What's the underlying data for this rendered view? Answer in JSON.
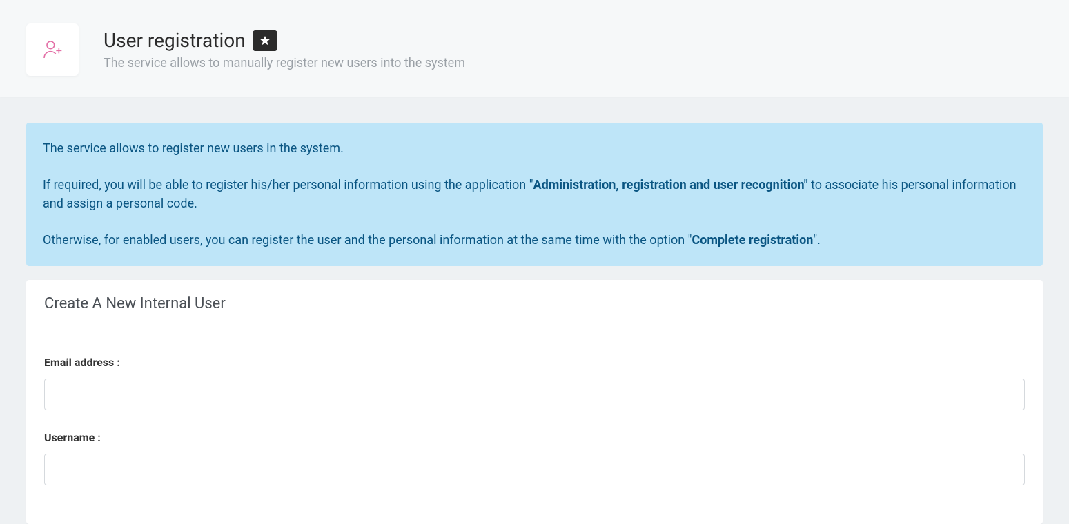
{
  "header": {
    "title": "User registration",
    "subtitle": "The service allows to manually register new users into the system"
  },
  "banner": {
    "line1": "The service allows to register new users in the system.",
    "line2_prefix": "If required, you will be able to register his/her personal information using the application \"",
    "line2_bold": "Administration, registration and user recognition\"",
    "line2_suffix": " to associate his personal information and assign a personal code.",
    "line3_prefix": "Otherwise, for enabled users, you can register the user and the personal information at the same time with the option \"",
    "line3_bold": "Complete registration",
    "line3_suffix": "\"."
  },
  "form": {
    "card_title": "Create A New Internal User",
    "email_label": "Email address :",
    "email_value": "",
    "username_label": "Username :",
    "username_value": ""
  }
}
